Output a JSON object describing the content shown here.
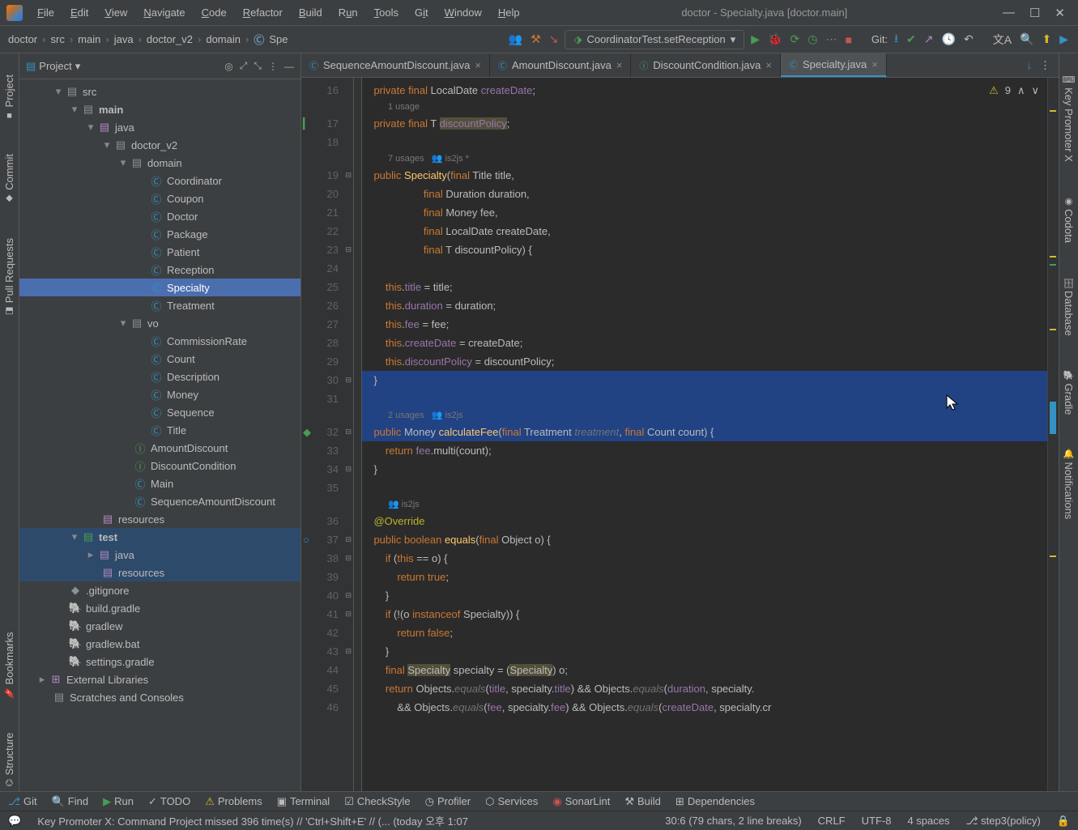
{
  "title": "doctor - Specialty.java [doctor.main]",
  "menu": [
    "File",
    "Edit",
    "View",
    "Navigate",
    "Code",
    "Refactor",
    "Build",
    "Run",
    "Tools",
    "Git",
    "Window",
    "Help"
  ],
  "breadcrumbs": [
    "doctor",
    "src",
    "main",
    "java",
    "doctor_v2",
    "domain"
  ],
  "crumb_icon_label": "Spe",
  "run_config": "CoordinatorTest.setReception",
  "git_label": "Git:",
  "project_label": "Project",
  "tree": {
    "src": "src",
    "main": "main",
    "java": "java",
    "doctor_v2": "doctor_v2",
    "domain": "domain",
    "domain_items": [
      "Coordinator",
      "Coupon",
      "Doctor",
      "Package",
      "Patient",
      "Reception",
      "Specialty",
      "Treatment"
    ],
    "vo": "vo",
    "vo_items": [
      "CommissionRate",
      "Count",
      "Description",
      "Money",
      "Sequence",
      "Title"
    ],
    "pkg_extra": [
      "AmountDiscount",
      "DiscountCondition",
      "Main",
      "SequenceAmountDiscount"
    ],
    "resources": "resources",
    "test": "test",
    "test_java": "java",
    "test_resources": "resources",
    "files": [
      ".gitignore",
      "build.gradle",
      "gradlew",
      "gradlew.bat",
      "settings.gradle"
    ],
    "ext_lib": "External Libraries",
    "scratches": "Scratches and Consoles"
  },
  "tabs": [
    {
      "label": "SequenceAmountDiscount.java",
      "active": false,
      "ic": "class"
    },
    {
      "label": "AmountDiscount.java",
      "active": false,
      "ic": "class"
    },
    {
      "label": "DiscountCondition.java",
      "active": false,
      "ic": "iface"
    },
    {
      "label": "Specialty.java",
      "active": true,
      "ic": "class"
    }
  ],
  "warnings": "9",
  "hints": {
    "u1": "1 usage",
    "u7": "7 usages",
    "u2": "2 usages",
    "auth": "is2js",
    "auth2": "is2js *"
  },
  "left_tabs": [
    "Project",
    "Commit",
    "Pull Requests"
  ],
  "left_tabs2": [
    "Bookmarks",
    "Structure"
  ],
  "right_tabs": [
    "Key Promoter X",
    "Codota",
    "Database",
    "Gradle",
    "Notifications"
  ],
  "bottom_tabs": [
    "Git",
    "Find",
    "Run",
    "TODO",
    "Problems",
    "Terminal",
    "CheckStyle",
    "Profiler",
    "Services",
    "SonarLint",
    "Build",
    "Dependencies"
  ],
  "status2_left": "Key Promoter X: Command Project missed 396 time(s) // 'Ctrl+Shift+E' // (... (today 오후 1:07",
  "status2": {
    "pos": "30:6 (79 chars, 2 line breaks)",
    "sep": "CRLF",
    "enc": "UTF-8",
    "indent": "4 spaces",
    "branch": "step3(policy)"
  }
}
